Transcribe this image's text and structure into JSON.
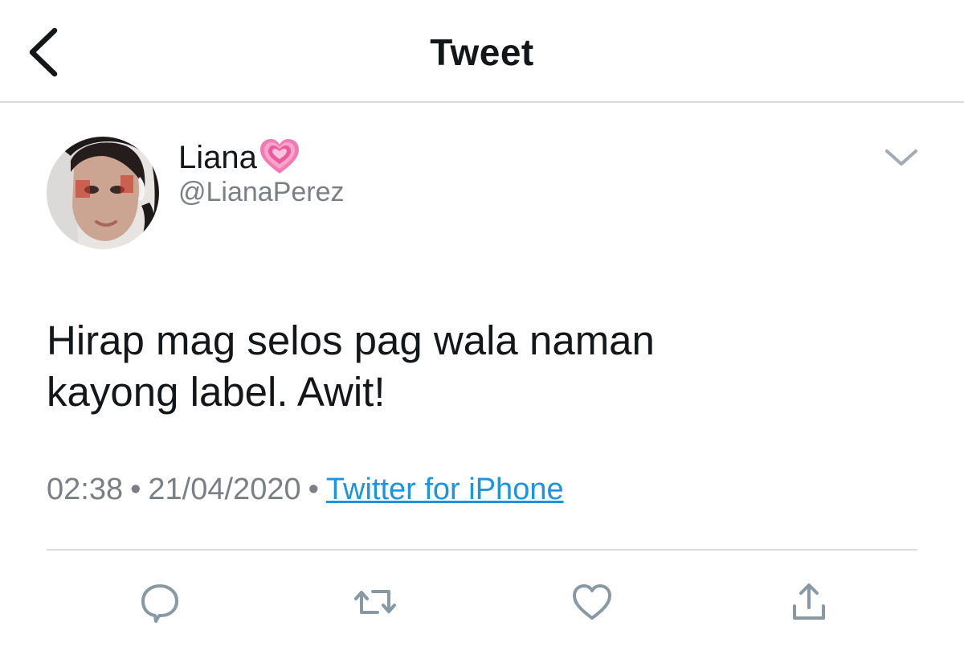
{
  "nav": {
    "title": "Tweet",
    "back_icon": "chevron-left-icon"
  },
  "tweet": {
    "display_name": "Liana",
    "name_emoji": "growing-heart-icon",
    "handle": "@LianaPerez",
    "text_line1": "Hirap mag selos pag wala naman",
    "text_line2": "kayong label. Awit!",
    "time": "02:38",
    "date": "21/04/2020",
    "separator": "•",
    "source": "Twitter for iPhone"
  },
  "actions": {
    "reply_icon": "reply-icon",
    "retweet_icon": "retweet-icon",
    "like_icon": "heart-outline-icon",
    "share_icon": "share-icon"
  },
  "colors": {
    "link": "#1b95e0",
    "muted_text": "#7a7f85",
    "primary_text": "#14171a",
    "icon_gray": "#8899a6",
    "divider": "#dcdcdc",
    "heart_pink": "#f06ea9"
  }
}
